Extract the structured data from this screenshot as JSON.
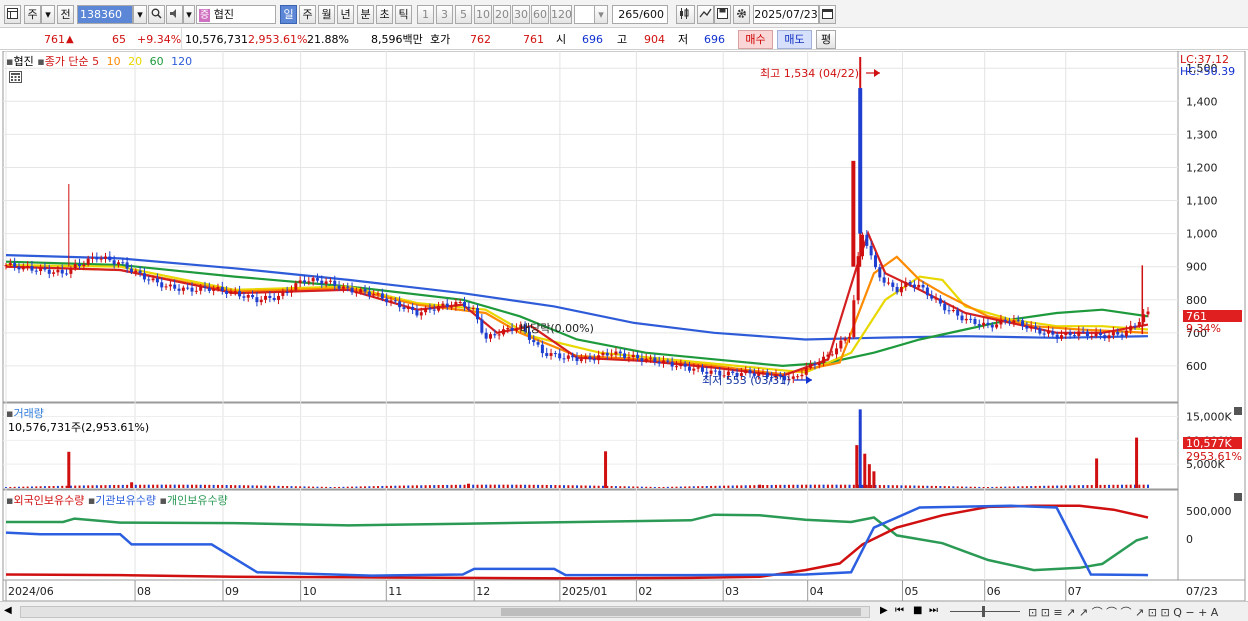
{
  "toolbar": {
    "period_mode": "주",
    "prev_label": "전",
    "code": "138360",
    "stock_name": "협진",
    "intervals": [
      "일",
      "주",
      "월",
      "년",
      "분",
      "초",
      "틱"
    ],
    "active_interval": "일",
    "minute_options": [
      "1",
      "3",
      "5",
      "10",
      "20",
      "30",
      "60",
      "120"
    ],
    "count": "265",
    "count_max": "/600",
    "date": "2025/07/23"
  },
  "quote": {
    "price": "761",
    "change_arrow": "▲",
    "change": "65",
    "change_pct": "+9.34%",
    "volume": "10,576,731",
    "volume_ratio": "2,953.61%",
    "turnover": "21.88%",
    "amount": "8,596백만",
    "hoga_label": "호가",
    "ask": "762",
    "bid": "761",
    "open_label": "시",
    "open": "696",
    "high_label": "고",
    "high": "904",
    "low_label": "저",
    "low": "696",
    "buy_label": "매수",
    "sell_label": "매도",
    "eval_label": "평"
  },
  "price_pane": {
    "name": "협진",
    "ma_prefix": "종가 단순",
    "ma_periods": [
      "5",
      "10",
      "20",
      "60",
      "120"
    ],
    "lc": "LC:37.12",
    "hc": "HC:-50.39",
    "max_marker": "최고 1,534 (04/22)",
    "min_marker": "최저 553 (03/31)",
    "ex_div_marker": "배당락(0.00%)",
    "price_tag": "761",
    "pct_tag": "9.34%"
  },
  "volume_pane": {
    "title": "거래량",
    "subtitle": "10,576,731주(2,953.61%)",
    "vol_tag": "10,577K",
    "vol_pct_tag": "2953.61%"
  },
  "holdings_pane": {
    "series": [
      "외국인보유수량",
      "기관보유수량",
      "개인보유수량"
    ]
  },
  "x_axis": [
    "2024/06",
    "08",
    "09",
    "10",
    "11",
    "12",
    "2025/01",
    "02",
    "03",
    "04",
    "05",
    "06",
    "07",
    "07/23"
  ],
  "colors": {
    "ma5": "#d42020",
    "ma10": "#ff8a00",
    "ma20": "#e8d800",
    "ma60": "#1e9a3c",
    "ma120": "#2e5bd8",
    "up": "#d01010",
    "down": "#1f3fd0",
    "foreign": "#d01010",
    "institution": "#2b5fe0",
    "individual": "#2a9a55"
  },
  "chart_data": {
    "type": "candlestick",
    "price_axis": [
      1500,
      1400,
      1300,
      1200,
      1100,
      1000,
      900,
      800,
      700,
      600
    ],
    "price_axis_labels": [
      "1,500",
      "1,400",
      "1,300",
      "1,200",
      "1,100",
      "1,000",
      "900",
      "800",
      "700",
      "600"
    ],
    "price_range": [
      500,
      1540
    ],
    "volume_axis_labels": [
      "15,000K",
      "10,000K",
      "5,000K"
    ],
    "volume_range": [
      0,
      17000
    ],
    "holdings_axis_labels": [
      "500,000",
      "0"
    ],
    "months": [
      {
        "label": "2024/06",
        "pos": 0.0
      },
      {
        "label": "08",
        "pos": 0.113
      },
      {
        "label": "09",
        "pos": 0.19
      },
      {
        "label": "10",
        "pos": 0.258
      },
      {
        "label": "11",
        "pos": 0.333
      },
      {
        "label": "12",
        "pos": 0.41
      },
      {
        "label": "2025/01",
        "pos": 0.485
      },
      {
        "label": "02",
        "pos": 0.552
      },
      {
        "label": "03",
        "pos": 0.628
      },
      {
        "label": "04",
        "pos": 0.702
      },
      {
        "label": "05",
        "pos": 0.785
      },
      {
        "label": "06",
        "pos": 0.857
      },
      {
        "label": "07",
        "pos": 0.928
      }
    ],
    "close_points": [
      [
        0.0,
        905
      ],
      [
        0.03,
        890
      ],
      [
        0.05,
        880
      ],
      [
        0.06,
        900
      ],
      [
        0.08,
        930
      ],
      [
        0.1,
        910
      ],
      [
        0.12,
        870
      ],
      [
        0.14,
        840
      ],
      [
        0.16,
        830
      ],
      [
        0.18,
        835
      ],
      [
        0.2,
        820
      ],
      [
        0.22,
        800
      ],
      [
        0.24,
        810
      ],
      [
        0.26,
        860
      ],
      [
        0.28,
        855
      ],
      [
        0.3,
        830
      ],
      [
        0.32,
        820
      ],
      [
        0.34,
        790
      ],
      [
        0.36,
        760
      ],
      [
        0.38,
        780
      ],
      [
        0.4,
        790
      ],
      [
        0.41,
        765
      ],
      [
        0.42,
        680
      ],
      [
        0.43,
        700
      ],
      [
        0.45,
        720
      ],
      [
        0.47,
        640
      ],
      [
        0.49,
        625
      ],
      [
        0.51,
        620
      ],
      [
        0.53,
        640
      ],
      [
        0.55,
        625
      ],
      [
        0.57,
        615
      ],
      [
        0.59,
        600
      ],
      [
        0.61,
        585
      ],
      [
        0.63,
        575
      ],
      [
        0.65,
        580
      ],
      [
        0.67,
        570
      ],
      [
        0.69,
        560
      ],
      [
        0.7,
        590
      ],
      [
        0.72,
        630
      ],
      [
        0.74,
        700
      ],
      [
        0.745,
        900
      ],
      [
        0.75,
        1000
      ],
      [
        0.755,
        960
      ],
      [
        0.76,
        900
      ],
      [
        0.77,
        850
      ],
      [
        0.78,
        830
      ],
      [
        0.79,
        850
      ],
      [
        0.8,
        840
      ],
      [
        0.82,
        780
      ],
      [
        0.84,
        740
      ],
      [
        0.86,
        720
      ],
      [
        0.88,
        740
      ],
      [
        0.9,
        710
      ],
      [
        0.92,
        690
      ],
      [
        0.94,
        700
      ],
      [
        0.96,
        690
      ],
      [
        0.98,
        700
      ],
      [
        1.0,
        761
      ]
    ],
    "ma120": [
      [
        0.0,
        935
      ],
      [
        0.1,
        925
      ],
      [
        0.2,
        895
      ],
      [
        0.3,
        860
      ],
      [
        0.4,
        820
      ],
      [
        0.48,
        780
      ],
      [
        0.55,
        730
      ],
      [
        0.62,
        700
      ],
      [
        0.7,
        680
      ],
      [
        0.76,
        685
      ],
      [
        0.84,
        690
      ],
      [
        0.92,
        685
      ],
      [
        1.0,
        690
      ]
    ],
    "ma60": [
      [
        0.0,
        915
      ],
      [
        0.1,
        905
      ],
      [
        0.2,
        870
      ],
      [
        0.3,
        840
      ],
      [
        0.4,
        800
      ],
      [
        0.45,
        750
      ],
      [
        0.5,
        680
      ],
      [
        0.56,
        640
      ],
      [
        0.62,
        620
      ],
      [
        0.68,
        600
      ],
      [
        0.72,
        610
      ],
      [
        0.76,
        640
      ],
      [
        0.8,
        680
      ],
      [
        0.84,
        710
      ],
      [
        0.88,
        740
      ],
      [
        0.92,
        760
      ],
      [
        0.96,
        770
      ],
      [
        1.0,
        750
      ]
    ],
    "ma20": [
      [
        0.0,
        905
      ],
      [
        0.1,
        900
      ],
      [
        0.2,
        830
      ],
      [
        0.3,
        840
      ],
      [
        0.36,
        790
      ],
      [
        0.42,
        770
      ],
      [
        0.46,
        690
      ],
      [
        0.52,
        640
      ],
      [
        0.58,
        620
      ],
      [
        0.64,
        600
      ],
      [
        0.7,
        580
      ],
      [
        0.74,
        640
      ],
      [
        0.77,
        800
      ],
      [
        0.8,
        870
      ],
      [
        0.82,
        860
      ],
      [
        0.84,
        780
      ],
      [
        0.88,
        740
      ],
      [
        0.92,
        720
      ],
      [
        0.96,
        720
      ],
      [
        1.0,
        710
      ]
    ],
    "ma10": [
      [
        0.0,
        900
      ],
      [
        0.1,
        890
      ],
      [
        0.2,
        825
      ],
      [
        0.3,
        835
      ],
      [
        0.36,
        785
      ],
      [
        0.42,
        760
      ],
      [
        0.45,
        700
      ],
      [
        0.5,
        630
      ],
      [
        0.56,
        620
      ],
      [
        0.62,
        600
      ],
      [
        0.68,
        575
      ],
      [
        0.73,
        610
      ],
      [
        0.76,
        880
      ],
      [
        0.78,
        930
      ],
      [
        0.8,
        860
      ],
      [
        0.82,
        820
      ],
      [
        0.86,
        750
      ],
      [
        0.9,
        720
      ],
      [
        0.94,
        710
      ],
      [
        1.0,
        700
      ]
    ],
    "ma5": [
      [
        0.0,
        900
      ],
      [
        0.1,
        890
      ],
      [
        0.2,
        820
      ],
      [
        0.3,
        830
      ],
      [
        0.36,
        770
      ],
      [
        0.4,
        785
      ],
      [
        0.43,
        700
      ],
      [
        0.46,
        720
      ],
      [
        0.5,
        625
      ],
      [
        0.56,
        615
      ],
      [
        0.62,
        595
      ],
      [
        0.68,
        570
      ],
      [
        0.72,
        620
      ],
      [
        0.745,
        900
      ],
      [
        0.755,
        1000
      ],
      [
        0.77,
        880
      ],
      [
        0.8,
        830
      ],
      [
        0.84,
        760
      ],
      [
        0.88,
        730
      ],
      [
        0.92,
        700
      ],
      [
        0.96,
        700
      ],
      [
        1.0,
        725
      ]
    ],
    "volume_spikes": [
      [
        0.055,
        7600
      ],
      [
        0.11,
        1200
      ],
      [
        0.405,
        900
      ],
      [
        0.525,
        7700
      ],
      [
        0.66,
        700
      ],
      [
        0.745,
        9000
      ],
      [
        0.748,
        16500
      ],
      [
        0.752,
        7200
      ],
      [
        0.756,
        5000
      ],
      [
        0.76,
        3500
      ],
      [
        0.955,
        6200
      ],
      [
        0.99,
        10577
      ]
    ],
    "foreign_holdings": [
      [
        0.0,
        -640
      ],
      [
        0.1,
        -650
      ],
      [
        0.2,
        -680
      ],
      [
        0.3,
        -690
      ],
      [
        0.4,
        -700
      ],
      [
        0.5,
        -710
      ],
      [
        0.6,
        -700
      ],
      [
        0.66,
        -680
      ],
      [
        0.7,
        -560
      ],
      [
        0.73,
        -440
      ],
      [
        0.75,
        -100
      ],
      [
        0.78,
        200
      ],
      [
        0.82,
        420
      ],
      [
        0.86,
        570
      ],
      [
        0.9,
        590
      ],
      [
        0.94,
        590
      ],
      [
        0.97,
        520
      ],
      [
        1.0,
        380
      ]
    ],
    "institution_holdings": [
      [
        0.0,
        110
      ],
      [
        0.03,
        80
      ],
      [
        0.1,
        80
      ],
      [
        0.11,
        -100
      ],
      [
        0.18,
        -100
      ],
      [
        0.22,
        -600
      ],
      [
        0.32,
        -660
      ],
      [
        0.4,
        -640
      ],
      [
        0.41,
        -540
      ],
      [
        0.48,
        -540
      ],
      [
        0.49,
        -650
      ],
      [
        0.6,
        -650
      ],
      [
        0.7,
        -640
      ],
      [
        0.74,
        -600
      ],
      [
        0.76,
        200
      ],
      [
        0.8,
        560
      ],
      [
        0.88,
        590
      ],
      [
        0.92,
        560
      ],
      [
        0.95,
        -640
      ],
      [
        1.0,
        -650
      ]
    ],
    "individual_holdings": [
      [
        0.0,
        300
      ],
      [
        0.05,
        300
      ],
      [
        0.06,
        360
      ],
      [
        0.1,
        290
      ],
      [
        0.2,
        280
      ],
      [
        0.3,
        240
      ],
      [
        0.4,
        270
      ],
      [
        0.5,
        300
      ],
      [
        0.6,
        330
      ],
      [
        0.62,
        430
      ],
      [
        0.66,
        420
      ],
      [
        0.7,
        340
      ],
      [
        0.74,
        300
      ],
      [
        0.76,
        380
      ],
      [
        0.78,
        60
      ],
      [
        0.82,
        -80
      ],
      [
        0.86,
        -380
      ],
      [
        0.9,
        -560
      ],
      [
        0.94,
        -520
      ],
      [
        0.96,
        -450
      ],
      [
        0.99,
        -30
      ],
      [
        1.0,
        30
      ]
    ]
  }
}
